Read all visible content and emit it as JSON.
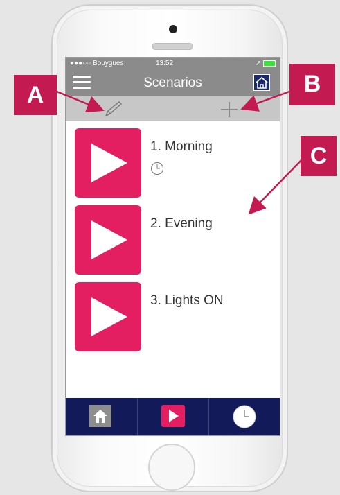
{
  "status": {
    "carrier": "●●●○○ Bouygues",
    "time": "13:52"
  },
  "nav": {
    "title": "Scenarios"
  },
  "scenarios": [
    {
      "label": "1. Morning",
      "has_timer": true
    },
    {
      "label": "2. Evening",
      "has_timer": false
    },
    {
      "label": "3. Lights ON",
      "has_timer": false
    }
  ],
  "callouts": {
    "a": "A",
    "b": "B",
    "c": "C"
  },
  "colors": {
    "accent": "#e41f61",
    "bar": "#8b8b8b",
    "tabbar": "#121a5a",
    "callout": "#c41a52"
  },
  "icons": [
    "menu-icon",
    "home-icon",
    "pencil-icon",
    "plus-icon",
    "play-icon",
    "clock-icon"
  ]
}
